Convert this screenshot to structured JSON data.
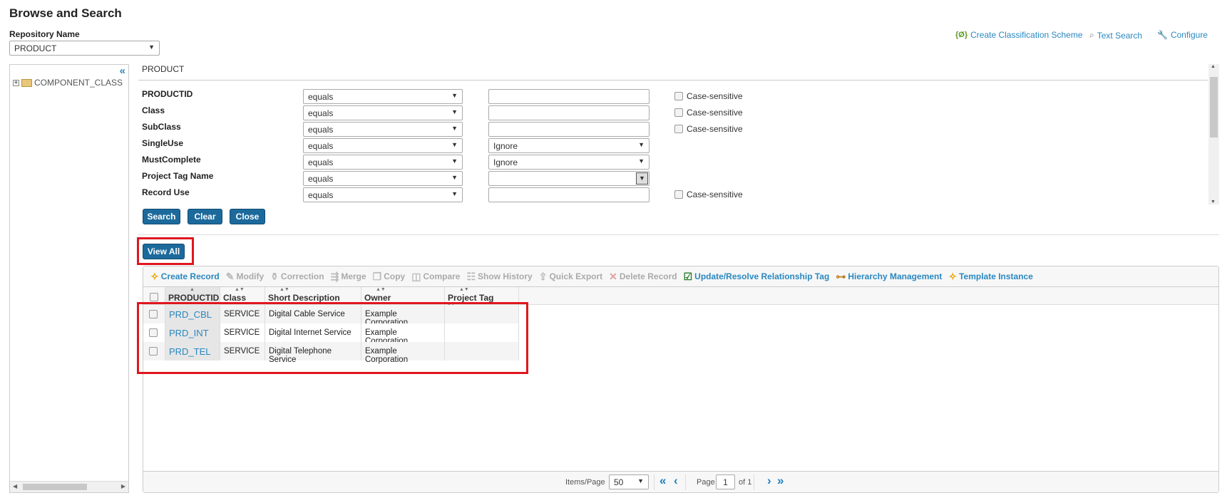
{
  "page": {
    "title": "Browse and Search"
  },
  "repository": {
    "label": "Repository Name",
    "value": "PRODUCT"
  },
  "top_links": [
    {
      "label": "Create Classification Scheme",
      "icon": "classification-icon"
    },
    {
      "label": "Text Search",
      "icon": "text-search-icon"
    },
    {
      "label": "Configure",
      "icon": "wrench-icon"
    }
  ],
  "tree": {
    "collapse": "«",
    "node": "COMPONENT_CLASS"
  },
  "search": {
    "header": "PRODUCT",
    "rows": [
      {
        "label": "PRODUCTID",
        "operator": "equals",
        "value": "",
        "case": "Case-sensitive"
      },
      {
        "label": "Class",
        "operator": "equals",
        "value": "",
        "case": "Case-sensitive"
      },
      {
        "label": "SubClass",
        "operator": "equals",
        "value": "",
        "case": "Case-sensitive"
      },
      {
        "label": "SingleUse",
        "operator": "equals",
        "value": "Ignore"
      },
      {
        "label": "MustComplete",
        "operator": "equals",
        "value": "Ignore"
      },
      {
        "label": "Project Tag Name",
        "operator": "equals",
        "value": ""
      },
      {
        "label": "Record Use",
        "operator": "equals",
        "value": "",
        "case": "Case-sensitive"
      }
    ],
    "buttons": {
      "search": "Search",
      "clear": "Clear",
      "close": "Close"
    }
  },
  "view_all": "View All",
  "toolbar": [
    {
      "label": "Create Record",
      "enabled": true,
      "icon": "star-icon"
    },
    {
      "label": "Modify",
      "enabled": false,
      "icon": "pencil-icon"
    },
    {
      "label": "Correction",
      "enabled": false,
      "icon": "bottle-icon"
    },
    {
      "label": "Merge",
      "enabled": false,
      "icon": "merge-icon"
    },
    {
      "label": "Copy",
      "enabled": false,
      "icon": "copy-icon"
    },
    {
      "label": "Compare",
      "enabled": false,
      "icon": "compare-icon"
    },
    {
      "label": "Show History",
      "enabled": false,
      "icon": "history-icon"
    },
    {
      "label": "Quick Export",
      "enabled": false,
      "icon": "export-icon"
    },
    {
      "label": "Delete Record",
      "enabled": false,
      "icon": "delete-icon"
    },
    {
      "label": "Update/Resolve Relationship Tag",
      "enabled": true,
      "icon": "checklist-icon"
    },
    {
      "label": "Hierarchy Management",
      "enabled": true,
      "icon": "hierarchy-icon"
    },
    {
      "label": "Template Instance",
      "enabled": true,
      "icon": "star-icon"
    }
  ],
  "grid": {
    "columns": [
      "PRODUCTID",
      "Class",
      "Short Description",
      "Owner",
      "Project Tag Name"
    ],
    "rows": [
      [
        "PRD_CBL",
        "SERVICE",
        "Digital Cable Service",
        "Example Corporation",
        ""
      ],
      [
        "PRD_INT",
        "SERVICE",
        "Digital Internet Service",
        "Example Corporation",
        ""
      ],
      [
        "PRD_TEL",
        "SERVICE",
        "Digital Telephone Service",
        "Example Corporation",
        ""
      ]
    ]
  },
  "pager": {
    "items_label": "Items/Page",
    "items_value": "50",
    "page_label": "Page",
    "page_value": "1",
    "of_label": "of 1"
  },
  "colors": {
    "accent": "#1c6a9c",
    "link": "#2a88c0",
    "highlight": "#e0161e"
  }
}
